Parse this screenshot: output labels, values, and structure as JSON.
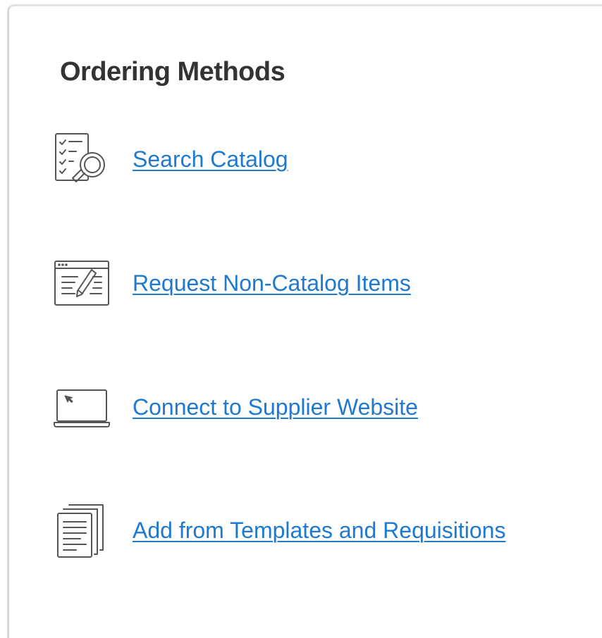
{
  "panel": {
    "title": "Ordering Methods",
    "link_color": "#1f79d0",
    "icon_color": "#555555"
  },
  "methods": [
    {
      "label": "Search Catalog",
      "icon": "checklist-magnifier-icon"
    },
    {
      "label": "Request Non-Catalog Items",
      "icon": "form-pencil-icon"
    },
    {
      "label": "Connect to Supplier Website",
      "icon": "laptop-cursor-icon"
    },
    {
      "label": "Add from Templates and Requisitions",
      "icon": "stacked-documents-icon"
    }
  ]
}
